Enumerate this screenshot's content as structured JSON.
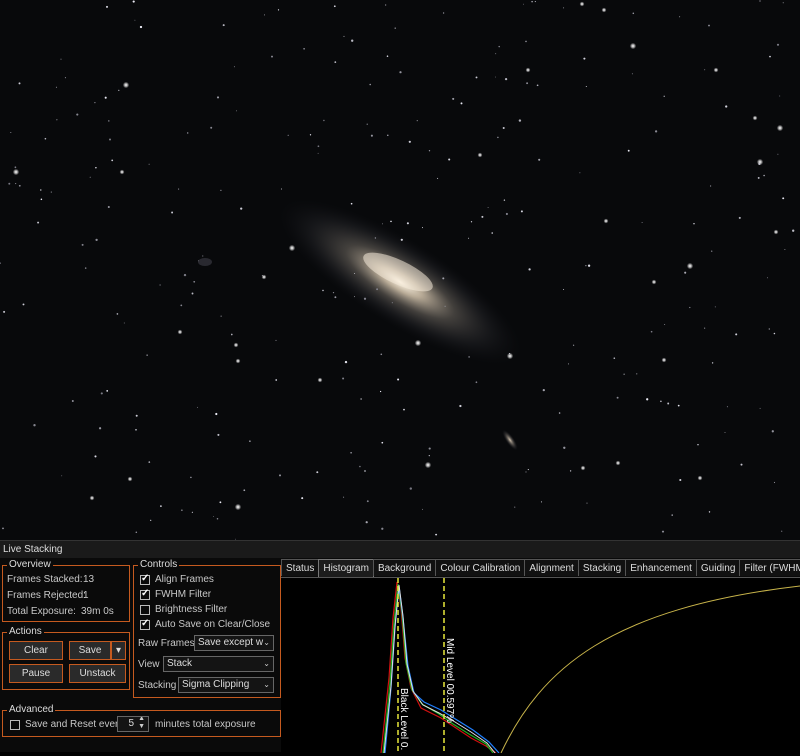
{
  "window_title": "Live Stacking",
  "overview": {
    "legend": "Overview",
    "frames_stacked_label": "Frames Stacked:",
    "frames_stacked_value": "13",
    "frames_rejected_label": "Frames Rejected:",
    "frames_rejected_value": "1",
    "total_exposure_label": "Total Exposure:",
    "total_exposure_value": "39m 0s"
  },
  "actions": {
    "legend": "Actions",
    "clear": "Clear",
    "save": "Save",
    "pause": "Pause",
    "unstack": "Unstack"
  },
  "controls": {
    "legend": "Controls",
    "align_frames": "Align Frames",
    "fwhm_filter": "FWHM Filter",
    "brightness_filter": "Brightness Filter",
    "auto_save": "Auto Save on Clear/Close",
    "raw_frames_label": "Raw Frames",
    "raw_frames_value": "Save except w",
    "view_label": "View",
    "view_value": "Stack",
    "stacking_label": "Stacking",
    "stacking_value": "Sigma Clipping"
  },
  "advanced": {
    "legend": "Advanced",
    "save_reset_label": "Save and Reset every",
    "minutes_value": "5",
    "minutes_suffix": "minutes total exposure"
  },
  "tabs": [
    "Status",
    "Histogram",
    "Background",
    "Colour Calibration",
    "Alignment",
    "Stacking",
    "Enhancement",
    "Guiding",
    "Filter (FWHM)"
  ],
  "histogram": {
    "black_level_label": "Black Level  0.",
    "mid_level_label": "Mid Level  00.597%"
  },
  "colors": {
    "accent": "#c55a1f",
    "level_marker": "#e8e83a",
    "curve": "#c8b44a"
  }
}
